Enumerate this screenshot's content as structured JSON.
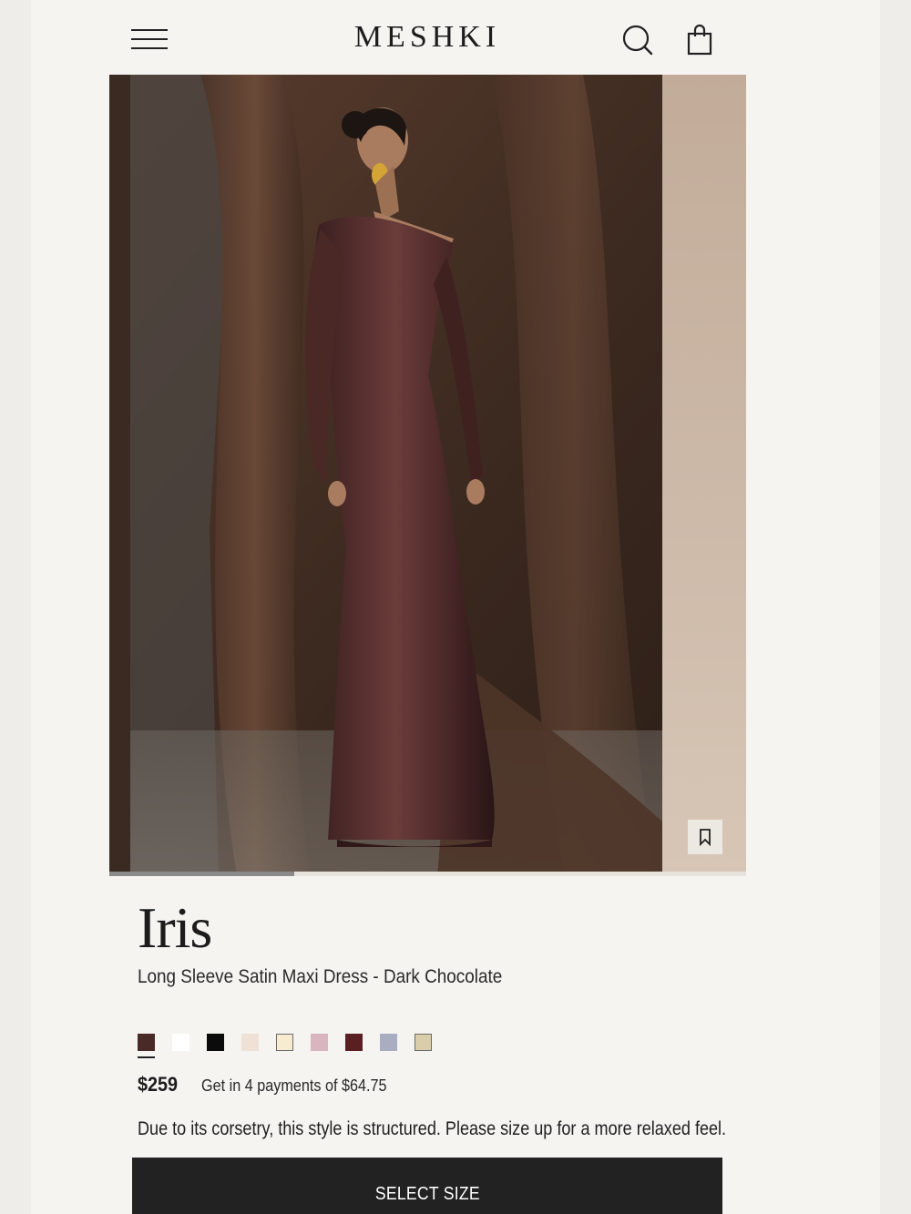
{
  "header": {
    "brand": "MESHKI",
    "menu_icon": "hamburger-menu-icon",
    "search_icon": "search-icon",
    "bag_icon": "shopping-bag-icon"
  },
  "gallery": {
    "image_progress": 0.29,
    "wishlist_icon": "bookmark-icon"
  },
  "product": {
    "name": "Iris",
    "subtitle": "Long Sleeve Satin Maxi Dress - Dark Chocolate",
    "price": "$259",
    "installments": "Get in 4 payments of $64.75",
    "fit_note": "Due to its corsetry, this style is structured. Please size up for a more relaxed feel.",
    "swatches": [
      {
        "color": "#4a2a26",
        "selected": true
      },
      {
        "color": "#ffffff",
        "selected": false
      },
      {
        "color": "#0b0b0b",
        "selected": false
      },
      {
        "color": "#efe1d6",
        "selected": false
      },
      {
        "color": "#f7ecd0",
        "selected": false,
        "outlined": true
      },
      {
        "color": "#d9b6bf",
        "selected": false
      },
      {
        "color": "#5a1f22",
        "selected": false
      },
      {
        "color": "#a9adc2",
        "selected": false
      },
      {
        "color": "#d9cdaa",
        "selected": false,
        "outlined": true
      }
    ]
  },
  "actions": {
    "select_size_label": "SELECT SIZE"
  }
}
